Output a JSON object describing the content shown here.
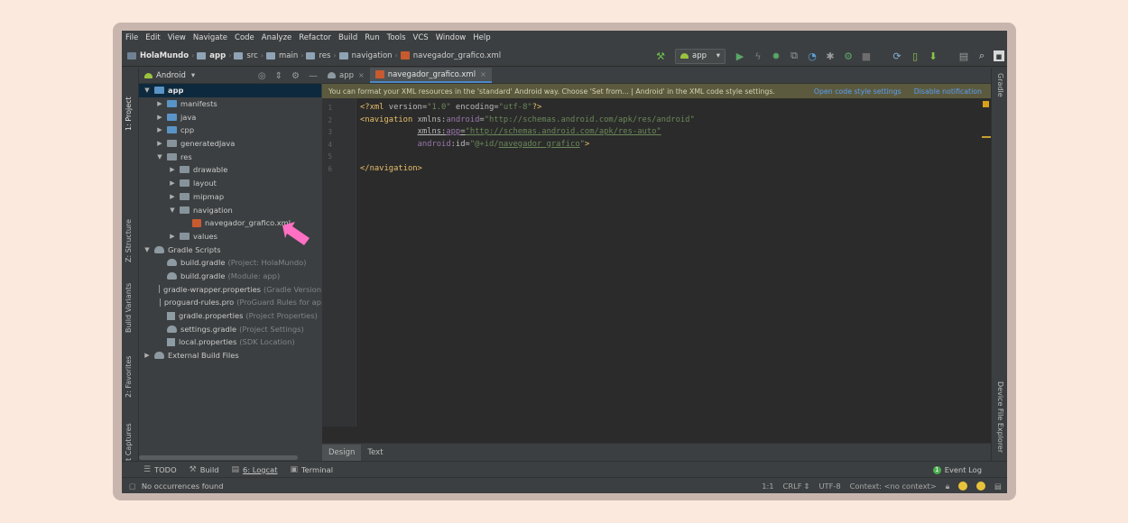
{
  "menu": [
    "File",
    "Edit",
    "View",
    "Navigate",
    "Code",
    "Analyze",
    "Refactor",
    "Build",
    "Run",
    "Tools",
    "VCS",
    "Window",
    "Help"
  ],
  "breadcrumb": {
    "project": "HolaMundo",
    "items": [
      "app",
      "src",
      "main",
      "res",
      "navigation"
    ],
    "file": "navegador_grafico.xml"
  },
  "run_config": "app",
  "left_strip": {
    "project": "1: Project",
    "structure": "Z: Structure",
    "build_variants": "Build Variants",
    "favorites": "2: Favorites",
    "layout_captures": "Layout Captures"
  },
  "right_strip": {
    "gradle": "Gradle",
    "device_file_explorer": "Device File Explorer"
  },
  "project_panel": {
    "view_mode": "Android",
    "tree": [
      {
        "label": "app",
        "hint": "",
        "depth": 0,
        "arrow": "▼",
        "icon": "module"
      },
      {
        "label": "manifests",
        "hint": "",
        "depth": 1,
        "arrow": "▶",
        "icon": "folder-blue"
      },
      {
        "label": "java",
        "hint": "",
        "depth": 1,
        "arrow": "▶",
        "icon": "folder-blue"
      },
      {
        "label": "cpp",
        "hint": "",
        "depth": 1,
        "arrow": "▶",
        "icon": "folder-blue"
      },
      {
        "label": "generatedJava",
        "hint": "",
        "depth": 1,
        "arrow": "▶",
        "icon": "folder"
      },
      {
        "label": "res",
        "hint": "",
        "depth": 1,
        "arrow": "▼",
        "icon": "folder"
      },
      {
        "label": "drawable",
        "hint": "",
        "depth": 2,
        "arrow": "▶",
        "icon": "folder"
      },
      {
        "label": "layout",
        "hint": "",
        "depth": 2,
        "arrow": "▶",
        "icon": "folder"
      },
      {
        "label": "mipmap",
        "hint": "",
        "depth": 2,
        "arrow": "▶",
        "icon": "folder"
      },
      {
        "label": "navigation",
        "hint": "",
        "depth": 2,
        "arrow": "▼",
        "icon": "folder"
      },
      {
        "label": "navegador_grafico.xml",
        "hint": "",
        "depth": 3,
        "arrow": "",
        "icon": "xml"
      },
      {
        "label": "values",
        "hint": "",
        "depth": 2,
        "arrow": "▶",
        "icon": "folder"
      },
      {
        "label": "Gradle Scripts",
        "hint": "",
        "depth": 0,
        "arrow": "▼",
        "icon": "gradle"
      },
      {
        "label": "build.gradle",
        "hint": "(Project: HolaMundo)",
        "depth": 1,
        "arrow": "",
        "icon": "gradle"
      },
      {
        "label": "build.gradle",
        "hint": "(Module: app)",
        "depth": 1,
        "arrow": "",
        "icon": "gradle"
      },
      {
        "label": "gradle-wrapper.properties",
        "hint": "(Gradle Version",
        "depth": 1,
        "arrow": "",
        "icon": "props"
      },
      {
        "label": "proguard-rules.pro",
        "hint": "(ProGuard Rules for ap",
        "depth": 1,
        "arrow": "",
        "icon": "props"
      },
      {
        "label": "gradle.properties",
        "hint": "(Project Properties)",
        "depth": 1,
        "arrow": "",
        "icon": "props"
      },
      {
        "label": "settings.gradle",
        "hint": "(Project Settings)",
        "depth": 1,
        "arrow": "",
        "icon": "gradle"
      },
      {
        "label": "local.properties",
        "hint": "(SDK Location)",
        "depth": 1,
        "arrow": "",
        "icon": "props"
      },
      {
        "label": "External Build Files",
        "hint": "",
        "depth": 0,
        "arrow": "▶",
        "icon": "ext"
      }
    ]
  },
  "editor": {
    "tabs": [
      {
        "label": "app",
        "active": false
      },
      {
        "label": "navegador_grafico.xml",
        "active": true
      }
    ],
    "notice": {
      "text": "You can format your XML resources in the 'standard' Android way. Choose 'Set from... | Android' in the XML code style settings.",
      "link1": "Open code style settings",
      "link2": "Disable notification"
    },
    "line_numbers": [
      "1",
      "2",
      "3",
      "4",
      "5",
      "6"
    ],
    "bottom_tabs": [
      {
        "label": "Design",
        "active": true
      },
      {
        "label": "Text",
        "active": false
      }
    ]
  },
  "toolwindows": {
    "todo": "TODO",
    "build": "Build",
    "logcat": "6: Logcat",
    "terminal": "Terminal",
    "event_log": "Event Log",
    "event_count": "1"
  },
  "status": {
    "message": "No occurrences found",
    "position": "1:1",
    "line_sep": "CRLF",
    "encoding": "UTF-8",
    "context": "Context: <no context>"
  },
  "colors": {
    "background": "#fce9dd",
    "frame": "#c8b6ae",
    "ide": "#3c3f41",
    "editor_bg": "#2b2b2b",
    "selection": "#0d293e",
    "accent_arrow": "#ff6fc3"
  }
}
